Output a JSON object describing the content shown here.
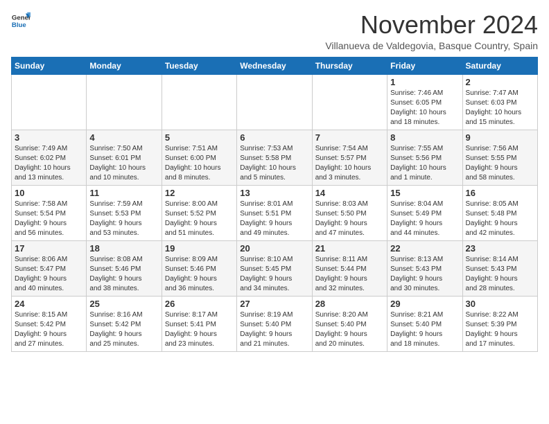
{
  "logo": {
    "general": "General",
    "blue": "Blue"
  },
  "header": {
    "month_title": "November 2024",
    "subtitle": "Villanueva de Valdegovia, Basque Country, Spain"
  },
  "weekdays": [
    "Sunday",
    "Monday",
    "Tuesday",
    "Wednesday",
    "Thursday",
    "Friday",
    "Saturday"
  ],
  "weeks": [
    [
      {
        "day": "",
        "info": ""
      },
      {
        "day": "",
        "info": ""
      },
      {
        "day": "",
        "info": ""
      },
      {
        "day": "",
        "info": ""
      },
      {
        "day": "",
        "info": ""
      },
      {
        "day": "1",
        "info": "Sunrise: 7:46 AM\nSunset: 6:05 PM\nDaylight: 10 hours\nand 18 minutes."
      },
      {
        "day": "2",
        "info": "Sunrise: 7:47 AM\nSunset: 6:03 PM\nDaylight: 10 hours\nand 15 minutes."
      }
    ],
    [
      {
        "day": "3",
        "info": "Sunrise: 7:49 AM\nSunset: 6:02 PM\nDaylight: 10 hours\nand 13 minutes."
      },
      {
        "day": "4",
        "info": "Sunrise: 7:50 AM\nSunset: 6:01 PM\nDaylight: 10 hours\nand 10 minutes."
      },
      {
        "day": "5",
        "info": "Sunrise: 7:51 AM\nSunset: 6:00 PM\nDaylight: 10 hours\nand 8 minutes."
      },
      {
        "day": "6",
        "info": "Sunrise: 7:53 AM\nSunset: 5:58 PM\nDaylight: 10 hours\nand 5 minutes."
      },
      {
        "day": "7",
        "info": "Sunrise: 7:54 AM\nSunset: 5:57 PM\nDaylight: 10 hours\nand 3 minutes."
      },
      {
        "day": "8",
        "info": "Sunrise: 7:55 AM\nSunset: 5:56 PM\nDaylight: 10 hours\nand 1 minute."
      },
      {
        "day": "9",
        "info": "Sunrise: 7:56 AM\nSunset: 5:55 PM\nDaylight: 9 hours\nand 58 minutes."
      }
    ],
    [
      {
        "day": "10",
        "info": "Sunrise: 7:58 AM\nSunset: 5:54 PM\nDaylight: 9 hours\nand 56 minutes."
      },
      {
        "day": "11",
        "info": "Sunrise: 7:59 AM\nSunset: 5:53 PM\nDaylight: 9 hours\nand 53 minutes."
      },
      {
        "day": "12",
        "info": "Sunrise: 8:00 AM\nSunset: 5:52 PM\nDaylight: 9 hours\nand 51 minutes."
      },
      {
        "day": "13",
        "info": "Sunrise: 8:01 AM\nSunset: 5:51 PM\nDaylight: 9 hours\nand 49 minutes."
      },
      {
        "day": "14",
        "info": "Sunrise: 8:03 AM\nSunset: 5:50 PM\nDaylight: 9 hours\nand 47 minutes."
      },
      {
        "day": "15",
        "info": "Sunrise: 8:04 AM\nSunset: 5:49 PM\nDaylight: 9 hours\nand 44 minutes."
      },
      {
        "day": "16",
        "info": "Sunrise: 8:05 AM\nSunset: 5:48 PM\nDaylight: 9 hours\nand 42 minutes."
      }
    ],
    [
      {
        "day": "17",
        "info": "Sunrise: 8:06 AM\nSunset: 5:47 PM\nDaylight: 9 hours\nand 40 minutes."
      },
      {
        "day": "18",
        "info": "Sunrise: 8:08 AM\nSunset: 5:46 PM\nDaylight: 9 hours\nand 38 minutes."
      },
      {
        "day": "19",
        "info": "Sunrise: 8:09 AM\nSunset: 5:46 PM\nDaylight: 9 hours\nand 36 minutes."
      },
      {
        "day": "20",
        "info": "Sunrise: 8:10 AM\nSunset: 5:45 PM\nDaylight: 9 hours\nand 34 minutes."
      },
      {
        "day": "21",
        "info": "Sunrise: 8:11 AM\nSunset: 5:44 PM\nDaylight: 9 hours\nand 32 minutes."
      },
      {
        "day": "22",
        "info": "Sunrise: 8:13 AM\nSunset: 5:43 PM\nDaylight: 9 hours\nand 30 minutes."
      },
      {
        "day": "23",
        "info": "Sunrise: 8:14 AM\nSunset: 5:43 PM\nDaylight: 9 hours\nand 28 minutes."
      }
    ],
    [
      {
        "day": "24",
        "info": "Sunrise: 8:15 AM\nSunset: 5:42 PM\nDaylight: 9 hours\nand 27 minutes."
      },
      {
        "day": "25",
        "info": "Sunrise: 8:16 AM\nSunset: 5:42 PM\nDaylight: 9 hours\nand 25 minutes."
      },
      {
        "day": "26",
        "info": "Sunrise: 8:17 AM\nSunset: 5:41 PM\nDaylight: 9 hours\nand 23 minutes."
      },
      {
        "day": "27",
        "info": "Sunrise: 8:19 AM\nSunset: 5:40 PM\nDaylight: 9 hours\nand 21 minutes."
      },
      {
        "day": "28",
        "info": "Sunrise: 8:20 AM\nSunset: 5:40 PM\nDaylight: 9 hours\nand 20 minutes."
      },
      {
        "day": "29",
        "info": "Sunrise: 8:21 AM\nSunset: 5:40 PM\nDaylight: 9 hours\nand 18 minutes."
      },
      {
        "day": "30",
        "info": "Sunrise: 8:22 AM\nSunset: 5:39 PM\nDaylight: 9 hours\nand 17 minutes."
      }
    ]
  ]
}
